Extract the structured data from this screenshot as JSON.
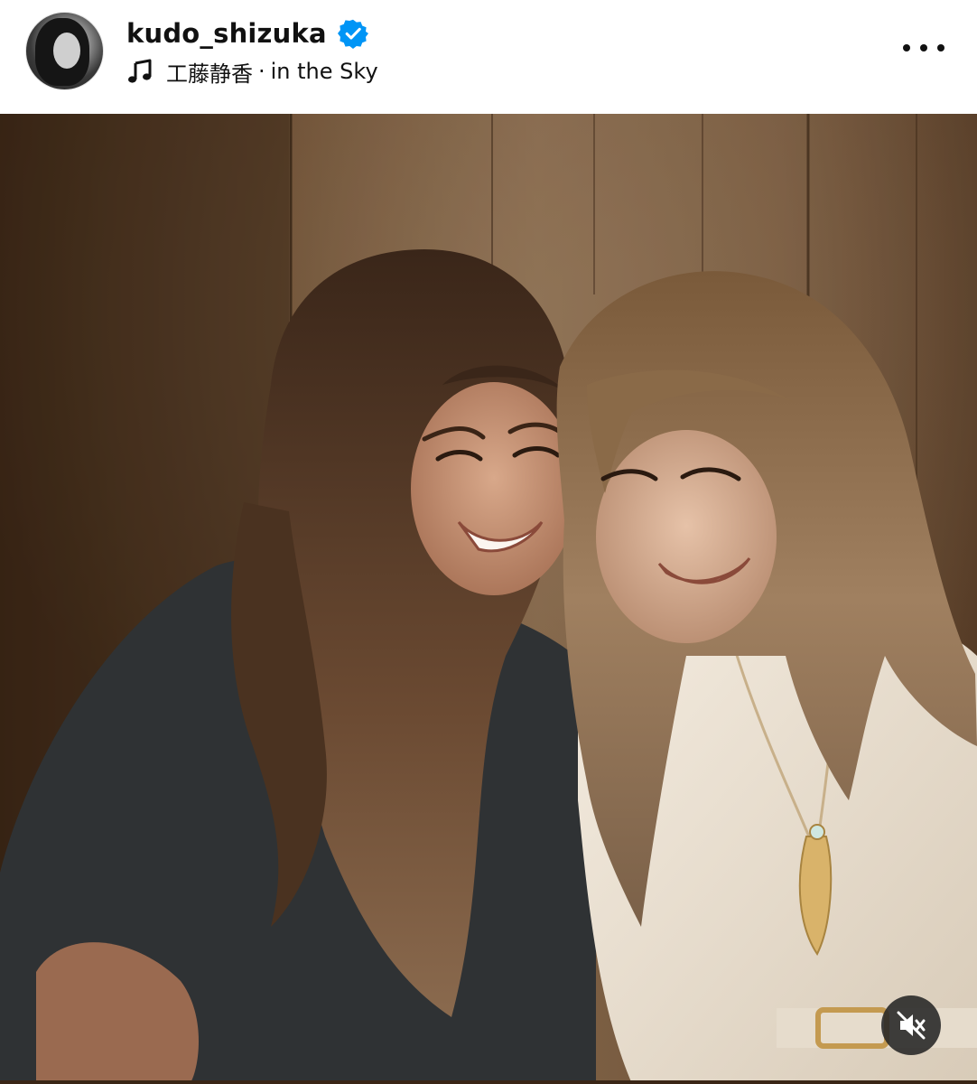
{
  "post": {
    "username": "kudo_shizuka",
    "verified": true,
    "music": {
      "artist": "工藤静香",
      "separator": "·",
      "track": "in the Sky"
    },
    "more_label": "More options"
  },
  "media": {
    "description": "Photo of two smiling women leaning their heads together against a dark wooden wall",
    "audio_state": "muted"
  },
  "icons": {
    "verified": "verified-badge-icon",
    "music": "music-note-icon",
    "more": "more-horizontal-icon",
    "mute": "speaker-muted-icon"
  },
  "colors": {
    "verified_badge": "#0095f6",
    "text": "#111111",
    "mute_bg": "#262626"
  }
}
